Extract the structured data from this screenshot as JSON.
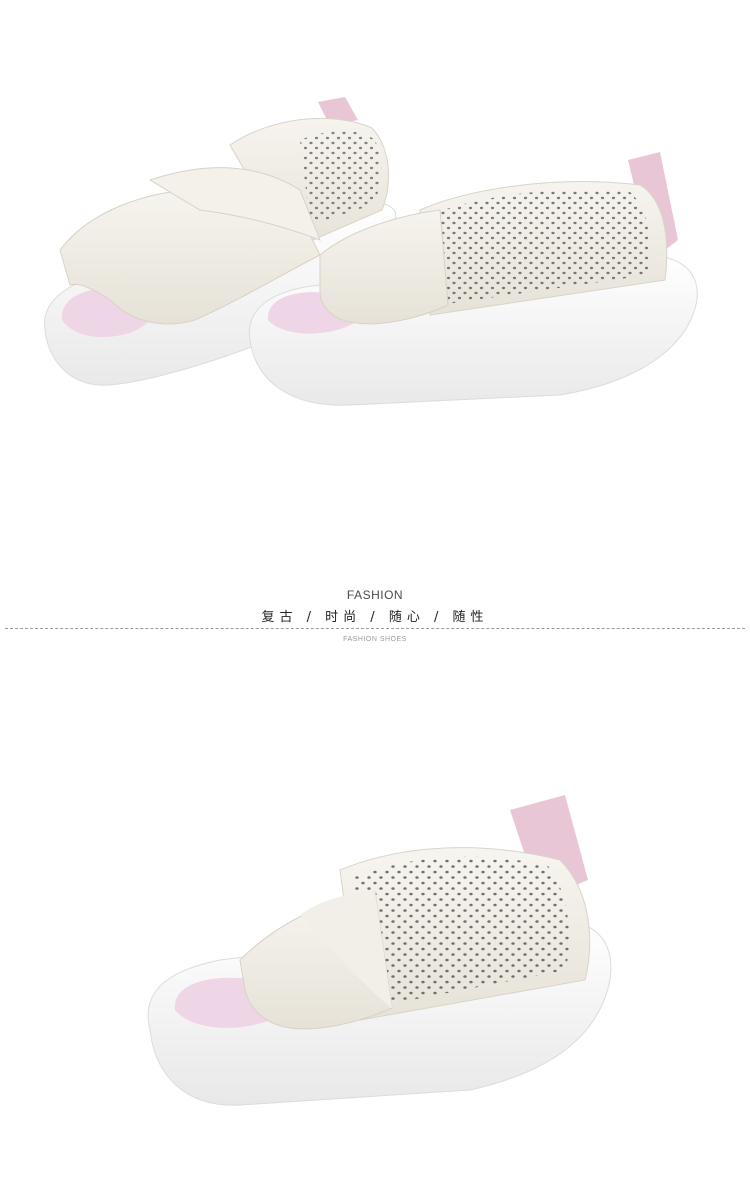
{
  "banner": {
    "title": "FASHION",
    "tagline": "复古 / 时尚 / 随心 / 随性",
    "caption": "FASHION SHOES"
  },
  "colors": {
    "background": "#ffffff",
    "leather": "#f1eee6",
    "sole": "#f8f8f8",
    "heel_tab": "#e9c6d6",
    "insole_pink": "#efd6e6",
    "text": "#222222",
    "muted": "#9a9a9a"
  }
}
